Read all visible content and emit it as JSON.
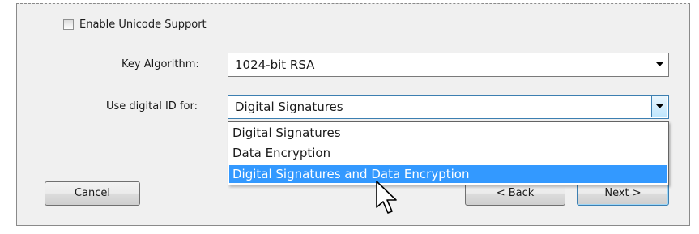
{
  "unicode": {
    "label": "Enable Unicode Support",
    "checked": false
  },
  "key_algorithm": {
    "label": "Key Algorithm:",
    "value": "1024-bit RSA"
  },
  "use_for": {
    "label": "Use digital ID for:",
    "value": "Digital Signatures",
    "options": [
      "Digital Signatures",
      "Data Encryption",
      "Digital Signatures and Data Encryption"
    ],
    "highlighted_index": 2
  },
  "buttons": {
    "cancel": "Cancel",
    "back": "< Back",
    "next": "Next >"
  },
  "colors": {
    "selection": "#3399ff",
    "focus_border": "#3c7fb1"
  }
}
